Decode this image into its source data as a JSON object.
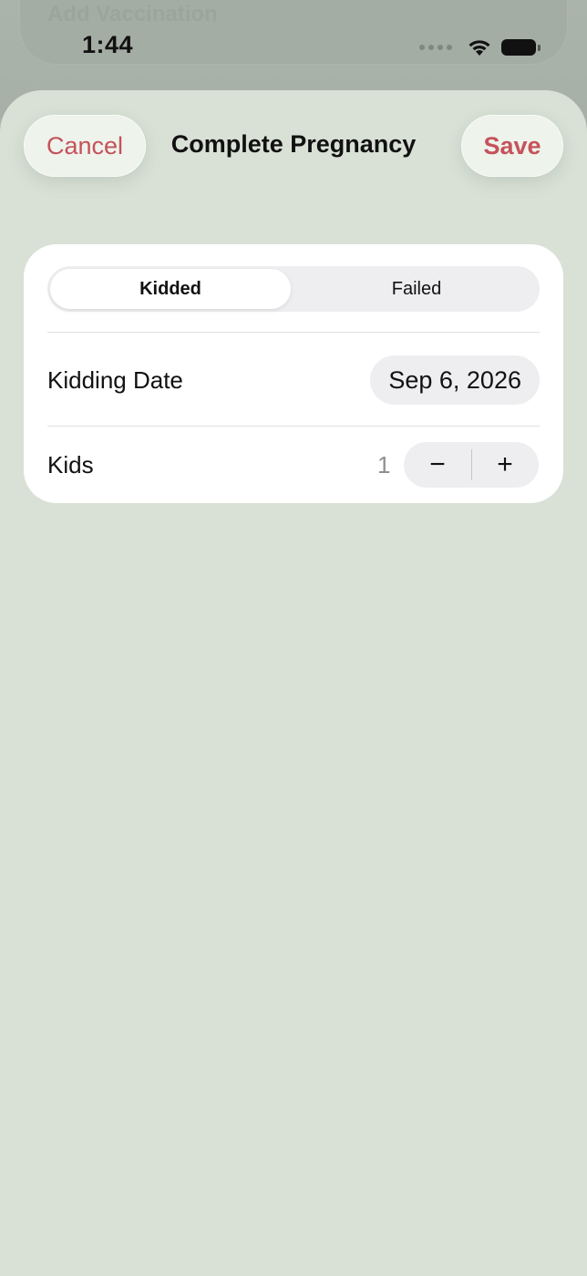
{
  "background": {
    "title": "Add Vaccination"
  },
  "status_bar": {
    "time": "1:44",
    "icons": [
      "signal-dots-icon",
      "wifi-icon",
      "battery-icon"
    ]
  },
  "sheet": {
    "title": "Complete Pregnancy",
    "cancel_label": "Cancel",
    "save_label": "Save",
    "accent_color": "#c5525a"
  },
  "form": {
    "outcome": {
      "options": [
        "Kidded",
        "Failed"
      ],
      "selected": "Kidded"
    },
    "kidding_date": {
      "label": "Kidding Date",
      "value": "Sep 6, 2026"
    },
    "kids": {
      "label": "Kids",
      "value": "1",
      "decrement_label": "−",
      "increment_label": "+"
    }
  }
}
